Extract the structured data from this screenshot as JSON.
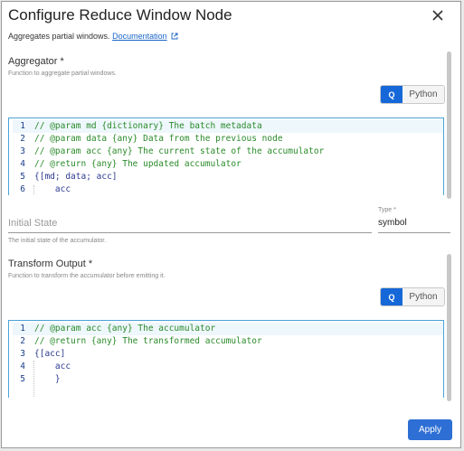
{
  "dialog": {
    "title": "Configure Reduce Window Node",
    "subtitle": "Aggregates partial windows.",
    "doc_link": "Documentation"
  },
  "aggregator": {
    "title": "Aggregator *",
    "description": "Function to aggregate partial windows.",
    "toggle": {
      "q": "Q",
      "python": "Python",
      "selected": "Q"
    },
    "code_lines": [
      {
        "num": "1",
        "text": "// @param md {dictionary} The batch metadata",
        "kind": "comment"
      },
      {
        "num": "2",
        "text": "// @param data {any} Data from the previous node",
        "kind": "comment"
      },
      {
        "num": "3",
        "text": "// @param acc {any} The current state of the accumulator",
        "kind": "comment"
      },
      {
        "num": "4",
        "text": "// @return {any} The updated accumulator",
        "kind": "comment"
      },
      {
        "num": "5",
        "text": "{[md; data; acc]",
        "kind": "code"
      },
      {
        "num": "6",
        "text": "    acc",
        "kind": "code"
      }
    ]
  },
  "initial_state": {
    "label": "Initial State",
    "help": "The initial state of the accumulator.",
    "type_label": "Type *",
    "type_value": "symbol"
  },
  "transform": {
    "title": "Transform Output *",
    "description": "Function to transform the accumulator before emitting it.",
    "toggle": {
      "q": "Q",
      "python": "Python",
      "selected": "Q"
    },
    "code_lines": [
      {
        "num": "1",
        "text": "// @param acc {any} The accumulator",
        "kind": "comment"
      },
      {
        "num": "2",
        "text": "// @return {any} The transformed accumulator",
        "kind": "comment"
      },
      {
        "num": "3",
        "text": "{[acc]",
        "kind": "code"
      },
      {
        "num": "4",
        "text": "    acc",
        "kind": "code"
      },
      {
        "num": "5",
        "text": "    }",
        "kind": "code"
      }
    ]
  },
  "footer": {
    "apply_label": "Apply"
  },
  "colors": {
    "accent": "#1668d8",
    "editor_border": "#4ba3d8",
    "comment": "#2a8a2a",
    "code": "#2b3a8f"
  }
}
